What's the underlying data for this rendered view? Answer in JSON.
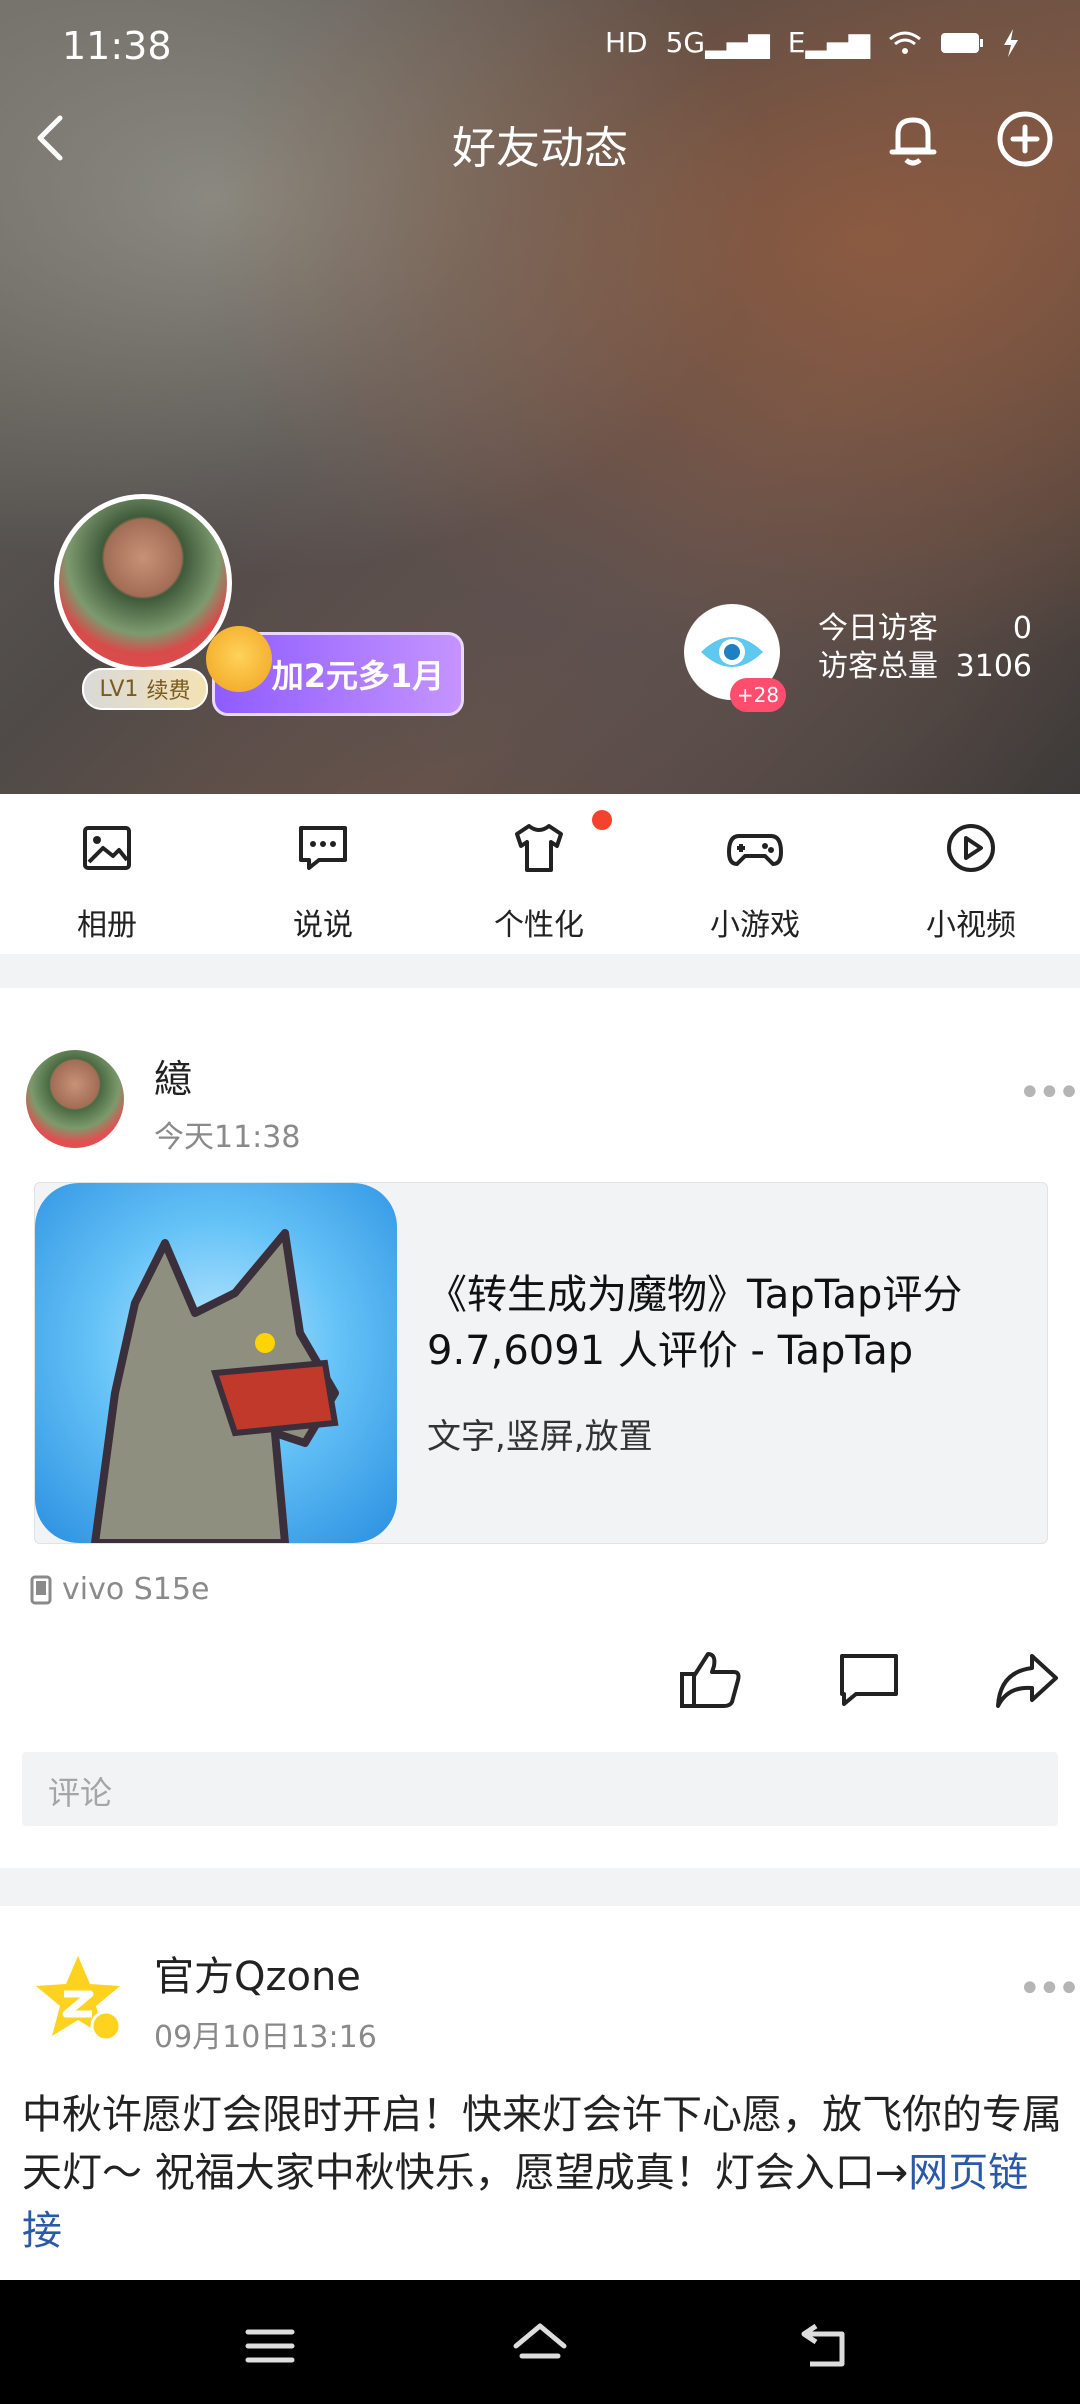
{
  "status": {
    "time": "11:38",
    "icons": [
      "HD",
      "5G",
      "E",
      "wifi",
      "battery",
      "charge"
    ]
  },
  "header": {
    "title": "好友动态"
  },
  "profile": {
    "level": "LV1",
    "renew": "续费",
    "promo": "加2元多1月",
    "visitor_badge": "+28",
    "today_label": "今日访客",
    "today_value": "0",
    "total_label": "访客总量",
    "total_value": "3106"
  },
  "quick_nav": [
    {
      "label": "相册",
      "icon": "photo-album-icon"
    },
    {
      "label": "说说",
      "icon": "chat-bubble-icon"
    },
    {
      "label": "个性化",
      "icon": "tshirt-icon"
    },
    {
      "label": "小游戏",
      "icon": "gamepad-icon"
    },
    {
      "label": "小视频",
      "icon": "play-video-icon"
    }
  ],
  "post1": {
    "name": "繶",
    "time": "今天11:38",
    "card_title": "《转生成为魔物》TapTap评分9.7,6091 人评价 - TapTap",
    "card_tags": "文字,竖屏,放置",
    "device": "vivo S15e",
    "comment_placeholder": "评论"
  },
  "post2": {
    "name": "官方Qzone",
    "time": "09月10日13:16",
    "text": "中秋许愿灯会限时开启！快来灯会许下心愿，放飞你的专属天灯～ 祝福大家中秋快乐，愿望成真！灯会入口→",
    "link": "网页链接"
  }
}
